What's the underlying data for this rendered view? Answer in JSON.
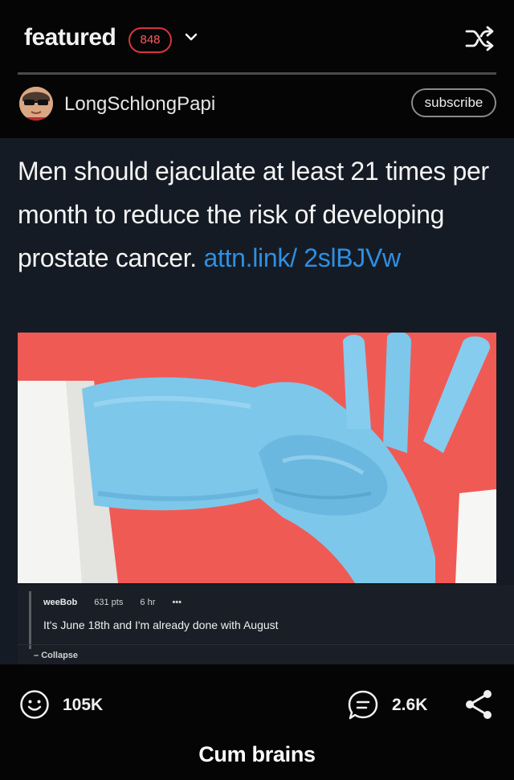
{
  "header": {
    "section_title": "featured",
    "badge_count": "848",
    "icons": [
      "chevron-down-icon",
      "shuffle-icon"
    ]
  },
  "post": {
    "author": "LongSchlongPapi",
    "subscribe_label": "subscribe",
    "tweet_text": "Men should ejaculate at least 21 times per month to reduce the risk of developing prostate cancer.",
    "tweet_link": "attn.link/ 2slBJVw"
  },
  "comment": {
    "author": "weeBob",
    "points": "631 pts",
    "time": "6 hr",
    "more": "•••",
    "text": "It's June 18th and I'm already done with August",
    "collapse_label": "Collapse"
  },
  "footer": {
    "upvotes": "105K",
    "comments": "2.6K",
    "caption": "Cum brains",
    "icons": [
      "smile-icon",
      "comment-icon",
      "share-icon"
    ]
  },
  "colors": {
    "background": "#050506",
    "badge": "#d8343e",
    "post_panel": "#151b24",
    "link": "#2f8fe0",
    "photo_bg": "#f05a55",
    "glove": "#7dc7ea"
  }
}
